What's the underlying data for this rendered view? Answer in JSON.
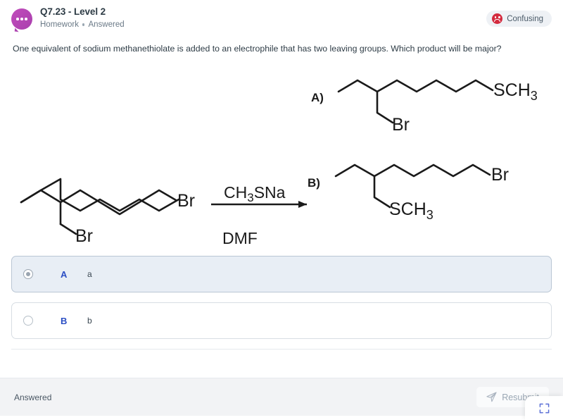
{
  "header": {
    "avatar_icon": "speech-bubble-dots-icon",
    "title": "Q7.23 - Level 2",
    "category": "Homework",
    "status": "Answered",
    "badge": {
      "icon": "confused-face-icon",
      "label": "Confusing",
      "bg_color": "#eef1f5",
      "icon_color": "#d32a3e"
    }
  },
  "question": {
    "text": "One equivalent of sodium methanethiolate is added to an electrophile that has two leaving groups. Which product will be major?"
  },
  "scheme": {
    "reactant_labels": {
      "terminal_br": "Br",
      "branch_br": "Br"
    },
    "reagent_above": "CH3SNa",
    "reagent_above_parts": {
      "pre": "CH",
      "sub": "3",
      "post": "SNa"
    },
    "reagent_below": "DMF",
    "product_a": {
      "tag": "A)",
      "terminal_label": "SCH3",
      "terminal_parts": {
        "pre": "SCH",
        "sub": "3"
      },
      "branch_label": "Br"
    },
    "product_b": {
      "tag": "B)",
      "terminal_label": "Br",
      "branch_label": "SCH3",
      "branch_parts": {
        "pre": "SCH",
        "sub": "3"
      }
    }
  },
  "options": [
    {
      "letter": "A",
      "label": "a",
      "selected": true
    },
    {
      "letter": "B",
      "label": "b",
      "selected": false
    }
  ],
  "footer": {
    "status": "Answered",
    "resubmit_label": "Resubmit",
    "resubmit_icon": "paper-plane-icon",
    "expand_icon": "expand-fullscreen-icon"
  },
  "colors": {
    "accent_blue": "#2b4ec4",
    "selected_bg": "#e8eef5",
    "avatar_purple": "#ad43b1",
    "badge_red": "#d32a3e"
  }
}
